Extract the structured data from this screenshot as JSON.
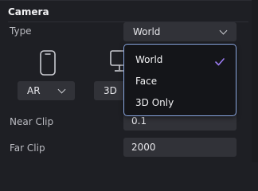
{
  "panel": {
    "title": "Camera",
    "type_label": "Type",
    "type_value": "World",
    "ar_button_label": "AR",
    "threed_button_label": "3D",
    "near_clip_label": "Near Clip",
    "near_clip_value": "0.1",
    "far_clip_label": "Far Clip",
    "far_clip_value": "2000"
  },
  "dropdown": {
    "options": [
      "World",
      "Face",
      "3D Only"
    ],
    "selected": "World",
    "check_color": "#9b7bf0"
  },
  "icons": {
    "phone": "phone-icon",
    "monitor": "monitor-icon",
    "chevron": "chevron-down-icon",
    "check": "checkmark-icon"
  },
  "colors": {
    "background": "#1e1f24",
    "field": "#313238",
    "popup_border": "#8aa7e0"
  }
}
